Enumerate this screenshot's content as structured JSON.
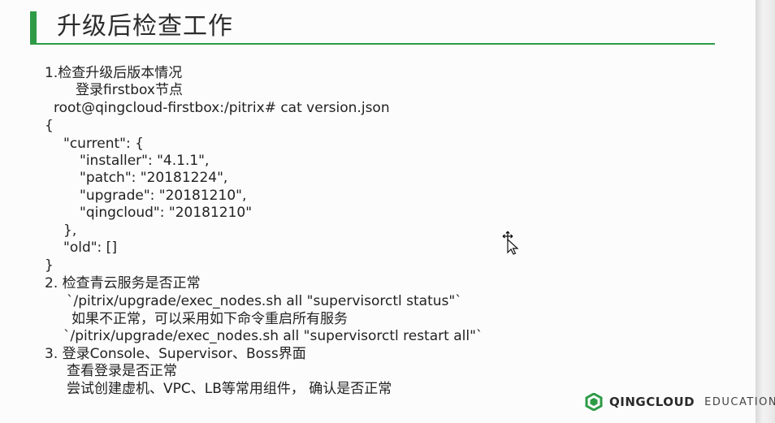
{
  "title": "升级后检查工作",
  "lines": [
    "1.检查升级后版本情况",
    "登录firstbox节点",
    "root@qingcloud-firstbox:/pitrix# cat version.json",
    "{",
    "\"current\": {",
    "\"installer\": \"4.1.1\",",
    "\"patch\": \"20181224\",",
    "\"upgrade\": \"20181210\",",
    "\"qingcloud\": \"20181210\"",
    "},",
    "\"old\": []",
    "}",
    "2. 检查青云服务是否正常",
    "`/pitrix/upgrade/exec_nodes.sh all \"supervisorctl status\"`",
    "如果不正常，可以采用如下命令重启所有服务",
    "`/pitrix/upgrade/exec_nodes.sh all \"supervisorctl restart all\"`",
    "3. 登录Console、Supervisor、Boss界面",
    "查看登录是否正常",
    "尝试创建虚机、VPC、LB等常用组件， 确认是否正常"
  ],
  "logo": {
    "brand": "QINGCLOUD",
    "sub": "EDUCATION",
    "color": "#2e9b47"
  }
}
